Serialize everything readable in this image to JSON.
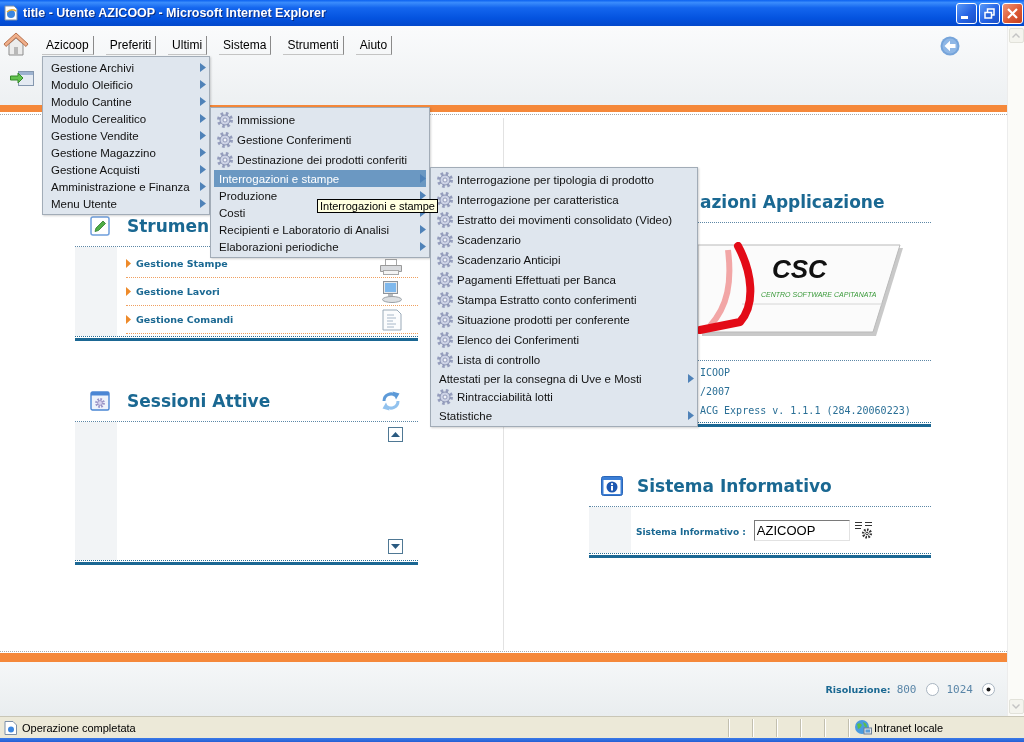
{
  "window": {
    "title": "title - Utente AZICOOP - Microsoft Internet Explorer"
  },
  "menubar": [
    {
      "label": "Azicoop"
    },
    {
      "label": "Preferiti"
    },
    {
      "label": "Ultimi"
    },
    {
      "label": "Sistema"
    },
    {
      "label": "Strumenti"
    },
    {
      "label": "Aiuto"
    }
  ],
  "menu": {
    "items": [
      {
        "label": "Gestione Archivi",
        "kind": "submenu",
        "selected": false
      },
      {
        "label": "Modulo Oleificio",
        "kind": "submenu",
        "selected": false
      },
      {
        "label": "Modulo Cantine",
        "kind": "submenu",
        "selected": false
      },
      {
        "label": "Modulo Cerealitico",
        "kind": "submenu",
        "selected": false,
        "children": [
          {
            "label": "Immissione",
            "kind": "action",
            "selected": false
          },
          {
            "label": "Gestione Conferimenti",
            "kind": "action",
            "selected": false
          },
          {
            "label": "Destinazione dei prodotti conferiti",
            "kind": "action",
            "selected": false
          },
          {
            "label": "Interrogazioni e stampe",
            "kind": "submenu",
            "selected": true,
            "children": [
              {
                "label": "Interrogazione per tipologia di prodotto",
                "kind": "action",
                "selected": false
              },
              {
                "label": "Interrogazione per caratteristica",
                "kind": "action",
                "selected": false
              },
              {
                "label": "Estratto dei movimenti consolidato (Video)",
                "kind": "action",
                "selected": false
              },
              {
                "label": "Scadenzario",
                "kind": "action",
                "selected": false
              },
              {
                "label": "Scadenzario Anticipi",
                "kind": "action",
                "selected": false
              },
              {
                "label": "Pagamenti Effettuati per Banca",
                "kind": "action",
                "selected": false
              },
              {
                "label": "Stampa Estratto conto conferimenti",
                "kind": "action",
                "selected": false
              },
              {
                "label": "Situazione prodotti per conferente",
                "kind": "action",
                "selected": false
              },
              {
                "label": "Elenco dei Conferimenti",
                "kind": "action",
                "selected": false
              },
              {
                "label": "Lista di controllo",
                "kind": "action",
                "selected": false
              },
              {
                "label": "Attestati per la consegna di Uve e Mosti",
                "kind": "submenu",
                "selected": false
              },
              {
                "label": "Rintracciabilità lotti",
                "kind": "action",
                "selected": false
              },
              {
                "label": "Statistiche",
                "kind": "submenu",
                "selected": false
              }
            ]
          },
          {
            "label": "Produzione",
            "kind": "submenu",
            "selected": false
          },
          {
            "label": "Costi",
            "kind": "submenu",
            "selected": false
          },
          {
            "label": "Recipienti e Laboratorio di Analisi",
            "kind": "submenu",
            "selected": false
          },
          {
            "label": "Elaborazioni periodiche",
            "kind": "submenu",
            "selected": false
          }
        ]
      },
      {
        "label": "Gestione Vendite",
        "kind": "submenu",
        "selected": false
      },
      {
        "label": "Gestione Magazzino",
        "kind": "submenu",
        "selected": false
      },
      {
        "label": "Gestione Acquisti",
        "kind": "submenu",
        "selected": false
      },
      {
        "label": "Amministrazione e Finanza",
        "kind": "submenu",
        "selected": false
      },
      {
        "label": "Menu Utente",
        "kind": "submenu",
        "selected": false
      }
    ]
  },
  "tooltip": {
    "text": "Interrogazioni e stampe"
  },
  "left_panels": [
    {
      "title": "Strumen",
      "kind": "tools",
      "items": [
        {
          "label": "Gestione Stampe"
        },
        {
          "label": "Gestione Lavori"
        },
        {
          "label": "Gestione Comandi"
        }
      ]
    },
    {
      "title": "Sessioni Attive",
      "kind": "sessions"
    }
  ],
  "right_panels": [
    {
      "title": "azioni Applicazione",
      "kind": "info",
      "logo": {
        "title": "CSC",
        "subtitle": "CENTRO SOFTWARE CAPITANATA"
      },
      "rows": [
        {
          "value": "ICOOP"
        },
        {
          "value": "/2007"
        },
        {
          "value": "ACG Express v. 1.1.1 (284.20060223)"
        }
      ]
    },
    {
      "title": "Sistema Informativo",
      "kind": "system",
      "field": {
        "label": "Sistema Informativo :",
        "value": "AZICOOP"
      }
    }
  ],
  "footer": {
    "label": "Risoluzione:",
    "options": [
      {
        "label": "800",
        "selected": false
      },
      {
        "label": "1024",
        "selected": true
      }
    ]
  },
  "status_bar": {
    "message": "Operazione completata",
    "zone": "Intranet locale"
  }
}
